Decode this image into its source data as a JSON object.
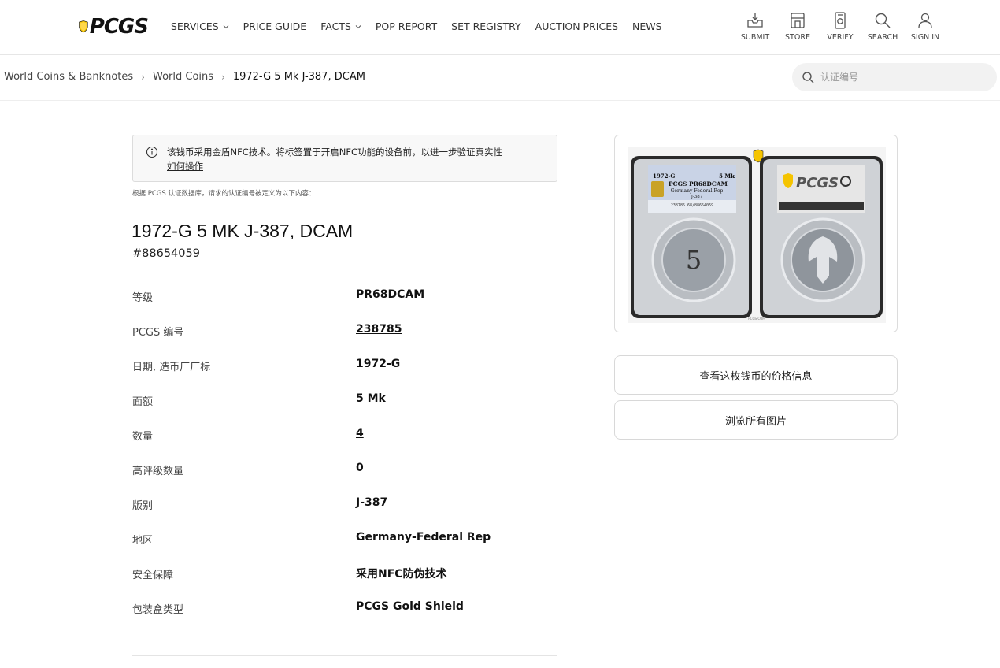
{
  "header": {
    "logo_text": "PCGS",
    "nav": [
      {
        "label": "SERVICES",
        "has_dropdown": true
      },
      {
        "label": "PRICE GUIDE",
        "has_dropdown": false
      },
      {
        "label": "FACTS",
        "has_dropdown": true
      },
      {
        "label": "POP REPORT",
        "has_dropdown": false
      },
      {
        "label": "SET REGISTRY",
        "has_dropdown": false
      },
      {
        "label": "AUCTION PRICES",
        "has_dropdown": false
      },
      {
        "label": "NEWS",
        "has_dropdown": false
      }
    ],
    "utilities": [
      {
        "label": "SUBMIT",
        "icon": "inbox-icon"
      },
      {
        "label": "STORE",
        "icon": "store-icon"
      },
      {
        "label": "VERIFY",
        "icon": "verify-icon"
      },
      {
        "label": "SEARCH",
        "icon": "search-icon"
      },
      {
        "label": "SIGN IN",
        "icon": "user-icon"
      }
    ]
  },
  "breadcrumb": {
    "items": [
      "World Coins & Banknotes",
      "World Coins"
    ],
    "current": "1972-G 5 Mk J-387, DCAM"
  },
  "search": {
    "placeholder": "认证编号"
  },
  "nfc_notice": {
    "message": "该钱币采用金盾NFC技术。将标签置于开启NFC功能的设备前，以进一步验证真实性",
    "link": "如何操作"
  },
  "db_note": "根据 PCGS 认证数据库，请求的认证编号被定义为以下内容：",
  "coin": {
    "title": "1972-G 5 MK J-387, DCAM",
    "cert_number": "#88654059"
  },
  "details": [
    {
      "label": "等级",
      "value": "PR68DCAM",
      "link": true
    },
    {
      "label": "PCGS 编号",
      "value": "238785",
      "link": true
    },
    {
      "label": "日期, 造币厂厂标",
      "value": "1972-G",
      "link": false
    },
    {
      "label": "面额",
      "value": "5 Mk",
      "link": false
    },
    {
      "label": "数量",
      "value": "4",
      "link": true
    },
    {
      "label": "高评级数量",
      "value": "0",
      "link": false
    },
    {
      "label": "版别",
      "value": "J-387",
      "link": false
    },
    {
      "label": "地区",
      "value": "Germany-Federal Rep",
      "link": false
    },
    {
      "label": "安全保障",
      "value": "采用NFC防伪技术",
      "link": false
    },
    {
      "label": "包装盒类型",
      "value": "PCGS Gold Shield",
      "link": false
    }
  ],
  "slab_label": {
    "year": "1972-G",
    "denomination": "5 Mk",
    "grade_line": "PCGS PR68DCAM",
    "region": "Germany-Federal Rep",
    "variety": "J-387",
    "codes": "238785.68/88654059",
    "footer": "PCGS.COM"
  },
  "buttons": {
    "price_info": "查看这枚钱币的价格信息",
    "browse_images": "浏览所有图片"
  },
  "colors": {
    "brand_yellow": "#f5c400",
    "text_dark": "#111111",
    "border": "#dcdcdc"
  }
}
